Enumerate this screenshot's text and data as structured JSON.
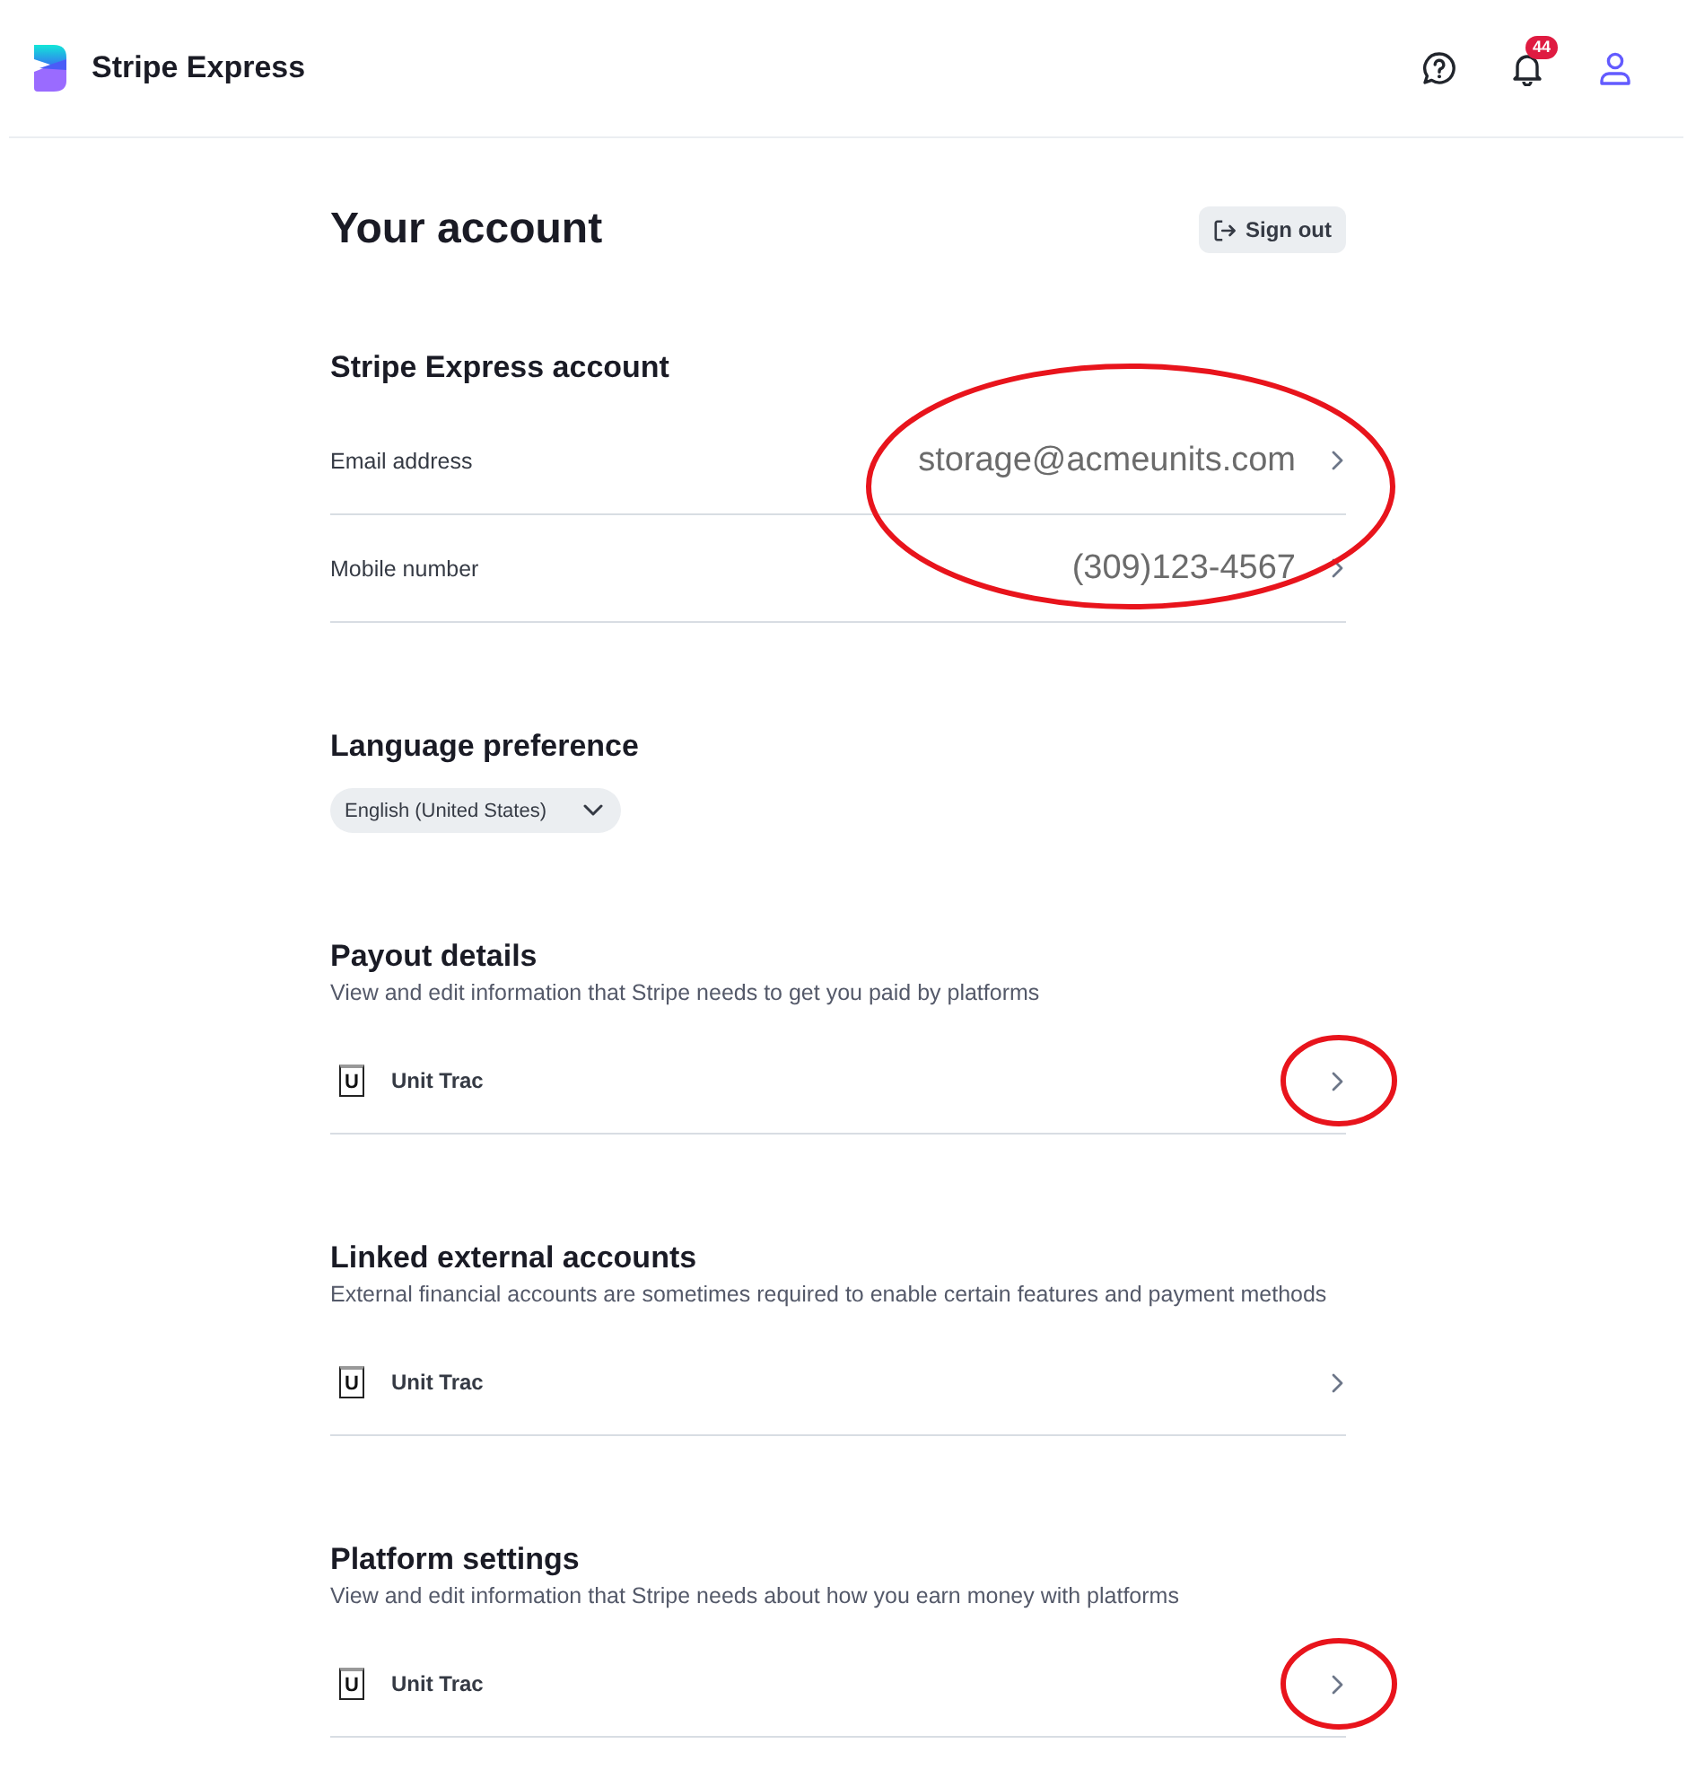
{
  "header": {
    "brand": "Stripe Express",
    "notification_count": "44"
  },
  "page": {
    "title": "Your account",
    "sign_out": "Sign out"
  },
  "sections": [
    {
      "kind": "fields",
      "title": "Stripe Express account",
      "circled": true,
      "rows": [
        {
          "label": "Email address",
          "value": "storage@acmeunits.com"
        },
        {
          "label": "Mobile number",
          "value": "(309)123-4567"
        }
      ]
    },
    {
      "kind": "select",
      "title": "Language preference",
      "value": "English (United States)"
    },
    {
      "kind": "links",
      "title": "Payout details",
      "description": "View and edit information that Stripe needs to get you paid by platforms",
      "items": [
        {
          "logo": "U",
          "name": "Unit Trac",
          "circled": true
        }
      ]
    },
    {
      "kind": "links",
      "title": "Linked external accounts",
      "description": "External financial accounts are sometimes required to enable certain features and payment methods",
      "items": [
        {
          "logo": "U",
          "name": "Unit Trac",
          "circled": false
        }
      ]
    },
    {
      "kind": "links",
      "title": "Platform settings",
      "description": "View and edit information that Stripe needs about how you earn money with platforms",
      "items": [
        {
          "logo": "U",
          "name": "Unit Trac",
          "circled": true
        }
      ]
    }
  ]
}
